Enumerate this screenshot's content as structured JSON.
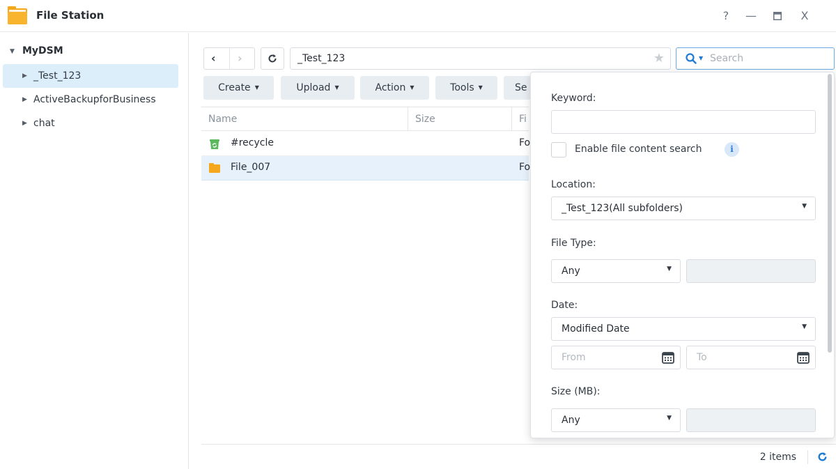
{
  "app": {
    "title": "File Station",
    "controls": {
      "help": "?",
      "minimize": "—",
      "maximize": "□",
      "close": "X"
    }
  },
  "sidebar": {
    "root": "MyDSM",
    "items": [
      {
        "label": "_Test_123",
        "selected": true
      },
      {
        "label": "ActiveBackupforBusiness",
        "selected": false
      },
      {
        "label": "chat",
        "selected": false
      }
    ]
  },
  "toolbar": {
    "path": "_Test_123",
    "search_placeholder": "Search",
    "buttons": {
      "create": "Create",
      "upload": "Upload",
      "action": "Action",
      "tools": "Tools",
      "settings": "Se"
    }
  },
  "file_list": {
    "columns": {
      "name": "Name",
      "size": "Size",
      "type": "Fi"
    },
    "rows": [
      {
        "name": "#recycle",
        "size": "",
        "type": "Fo",
        "icon": "recycle-bin-icon"
      },
      {
        "name": "File_007",
        "size": "",
        "type": "Fo",
        "icon": "folder-icon"
      }
    ]
  },
  "status": {
    "count": "2 items"
  },
  "search_panel": {
    "keyword_label": "Keyword:",
    "keyword_value": "",
    "content_search_label": "Enable file content search",
    "content_search_checked": false,
    "info_glyph": "i",
    "location_label": "Location:",
    "location_value": "_Test_123(All subfolders)",
    "file_type_label": "File Type:",
    "file_type_value": "Any",
    "date_label": "Date:",
    "date_value": "Modified Date",
    "from_placeholder": "From",
    "to_placeholder": "To",
    "size_label": "Size (MB):",
    "size_value": "Any"
  },
  "colors": {
    "accent": "#1e7bd6",
    "folder": "#f5a81c",
    "recycle": "#5cb85c",
    "selection": "#ddeefb"
  }
}
